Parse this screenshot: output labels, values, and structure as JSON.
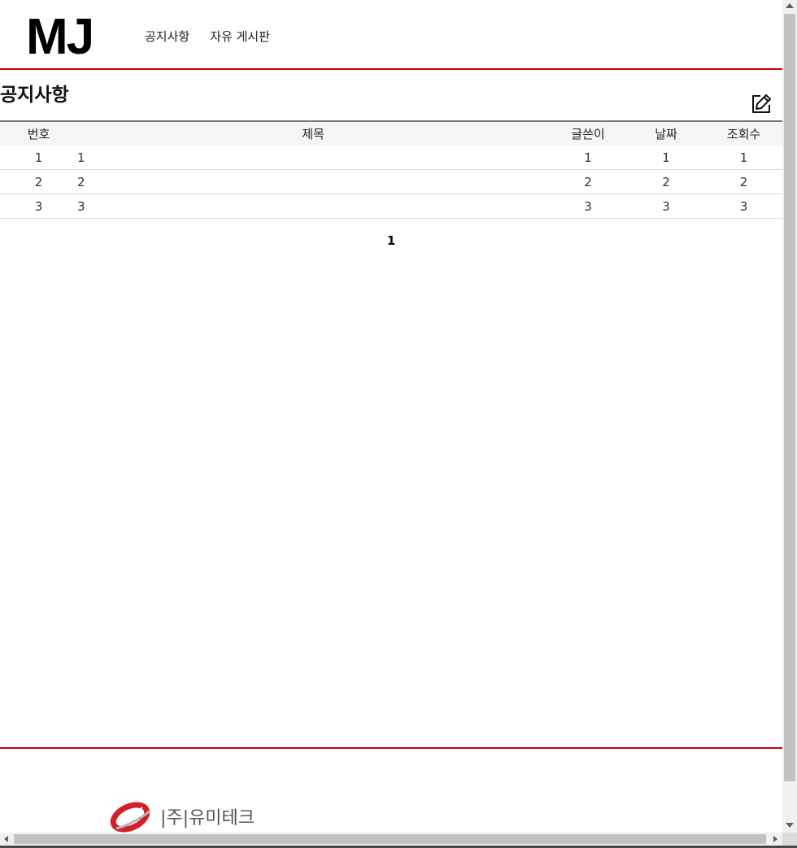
{
  "header": {
    "logo": "MJ",
    "nav": [
      "공지사항",
      "자유 게시판"
    ]
  },
  "page_title": "공지사항",
  "write_button": {
    "icon": "edit-icon"
  },
  "table": {
    "columns": [
      "번호",
      "제목",
      "글쓴이",
      "날짜",
      "조회수"
    ],
    "rows": [
      [
        "1",
        "1",
        "1",
        "1",
        "1"
      ],
      [
        "2",
        "2",
        "2",
        "2",
        "2"
      ],
      [
        "3",
        "3",
        "3",
        "3",
        "3"
      ]
    ]
  },
  "pagination": {
    "current": "1"
  },
  "footer": {
    "company": "|주|유미테크"
  },
  "colors": {
    "accent": "#c40000",
    "header_bg": "#f4f5f4",
    "logo_red": "#d21f2a"
  }
}
